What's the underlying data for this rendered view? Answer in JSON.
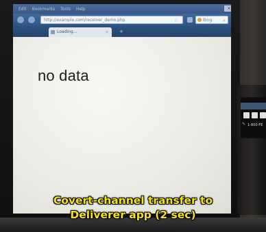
{
  "browser": {
    "menu_items": [
      "Edit",
      "Bookmarks",
      "Tools",
      "Help"
    ],
    "url": "http://example.com/receiver_demo.php",
    "search_placeholder": "Bing",
    "tab_title": "Loading..."
  },
  "page": {
    "message": "no data"
  },
  "phone": {
    "number": "1-800-FE"
  },
  "caption": {
    "line1": "Covert-channel transfer to",
    "line2": "Deliverer app (2 sec)"
  },
  "colors": {
    "caption_text": "#f4e31a",
    "browser_chrome": "#3e6a9b",
    "page_background": "#efefeb"
  }
}
